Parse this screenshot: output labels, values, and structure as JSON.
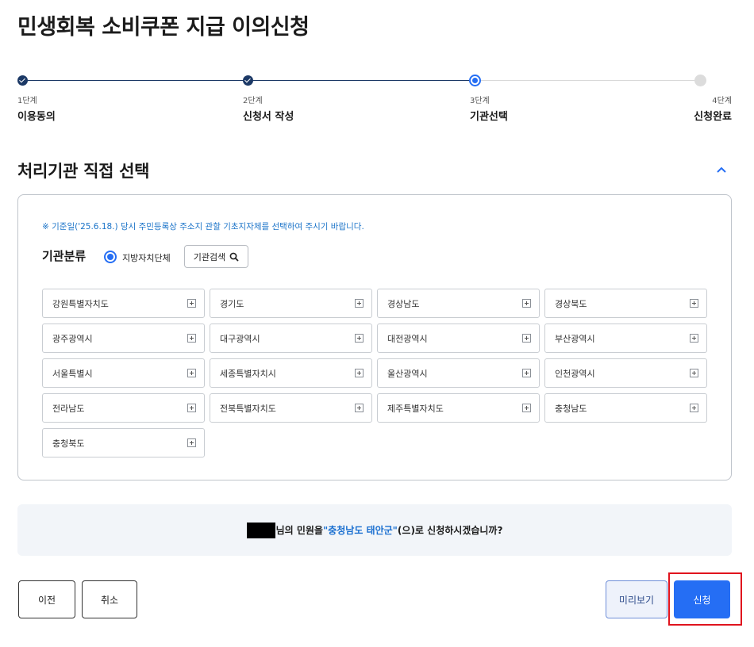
{
  "page": {
    "title": "민생회복 소비쿠폰 지급 이의신청"
  },
  "stepper": {
    "steps": [
      {
        "num": "1단계",
        "name": "이용동의",
        "state": "done"
      },
      {
        "num": "2단계",
        "name": "신청서 작성",
        "state": "done"
      },
      {
        "num": "3단계",
        "name": "기관선택",
        "state": "current"
      },
      {
        "num": "4단계",
        "name": "신청완료",
        "state": "todo"
      }
    ]
  },
  "section": {
    "title": "처리기관 직접 선택"
  },
  "panel": {
    "notice": "※ 기준일('25.6.18.) 당시 주민등록상 주소지 관할 기초지자체를 선택하여 주시기 바랍니다.",
    "category_label": "기관분류",
    "radio_label": "지방자치단체",
    "search_label": "기관검색",
    "regions": [
      "강원특별자치도",
      "경기도",
      "경상남도",
      "경상북도",
      "광주광역시",
      "대구광역시",
      "대전광역시",
      "부산광역시",
      "서울특별시",
      "세종특별자치시",
      "울산광역시",
      "인천광역시",
      "전라남도",
      "전북특별자치도",
      "제주특별자치도",
      "충청남도",
      "충청북도"
    ]
  },
  "confirm": {
    "prefix": "님의 민원을 ",
    "org": "\"충청남도 태안군\"",
    "suffix": "(으)로 신청하시겠습니까?"
  },
  "buttons": {
    "prev": "이전",
    "cancel": "취소",
    "preview": "미리보기",
    "apply": "신청"
  },
  "colors": {
    "primary": "#256ef4",
    "step_done": "#1c3966",
    "notice": "#1a73c8",
    "highlight_frame": "#e0141e"
  }
}
